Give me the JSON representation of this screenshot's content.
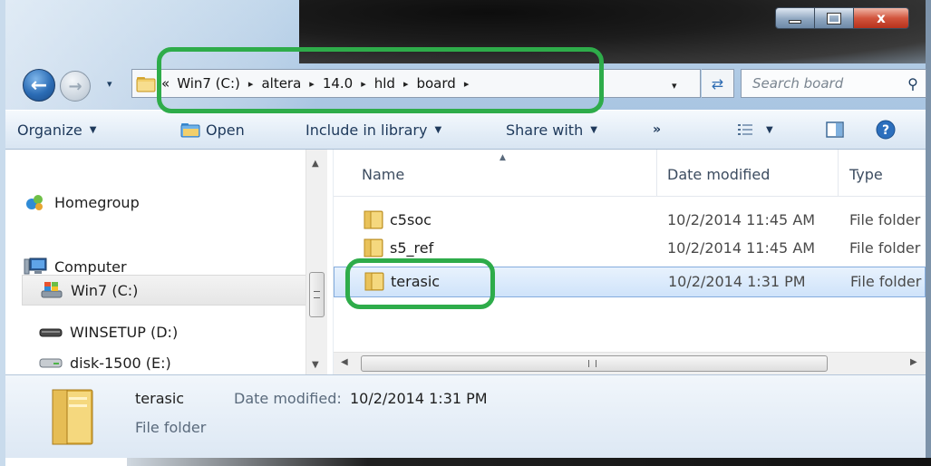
{
  "window": {
    "caption_buttons": {
      "minimize": "minimize",
      "maximize": "maximize",
      "close": "x"
    }
  },
  "navigation": {
    "recent_pages_glyph": "▾"
  },
  "address_bar": {
    "overflow_glyph": "«",
    "crumbs": [
      "Win7 (C:)",
      "altera",
      "14.0",
      "hld",
      "board"
    ],
    "separator": "▸",
    "dropdown_glyph": "▾"
  },
  "search": {
    "placeholder": "Search board"
  },
  "toolbar": {
    "organize": "Organize",
    "open": "Open",
    "include_in_library": "Include in library",
    "share_with": "Share with",
    "more": "»"
  },
  "nav_pane": {
    "homegroup": "Homegroup",
    "computer": "Computer",
    "drives": [
      {
        "label": "Win7 (C:)",
        "selected": true
      },
      {
        "label": "WINSETUP (D:)"
      },
      {
        "label": "disk-1500 (E:)"
      }
    ]
  },
  "file_list": {
    "columns": {
      "name": "Name",
      "date_modified": "Date modified",
      "type": "Type"
    },
    "rows": [
      {
        "name": "c5soc",
        "date": "10/2/2014 11:45 AM",
        "type": "File folder"
      },
      {
        "name": "s5_ref",
        "date": "10/2/2014 11:45 AM",
        "type": "File folder"
      },
      {
        "name": "terasic",
        "date": "10/2/2014 1:31 PM",
        "type": "File folder",
        "selected": true
      }
    ],
    "hscroll_grip": "III"
  },
  "details": {
    "name": "terasic",
    "date_label": "Date modified:",
    "date_value": "10/2/2014 1:31 PM",
    "type": "File folder"
  },
  "colors": {
    "highlight_annotation": "#2eac4a",
    "selection_fill": "#cfe3fa",
    "toolbar_text": "#1e395b"
  }
}
